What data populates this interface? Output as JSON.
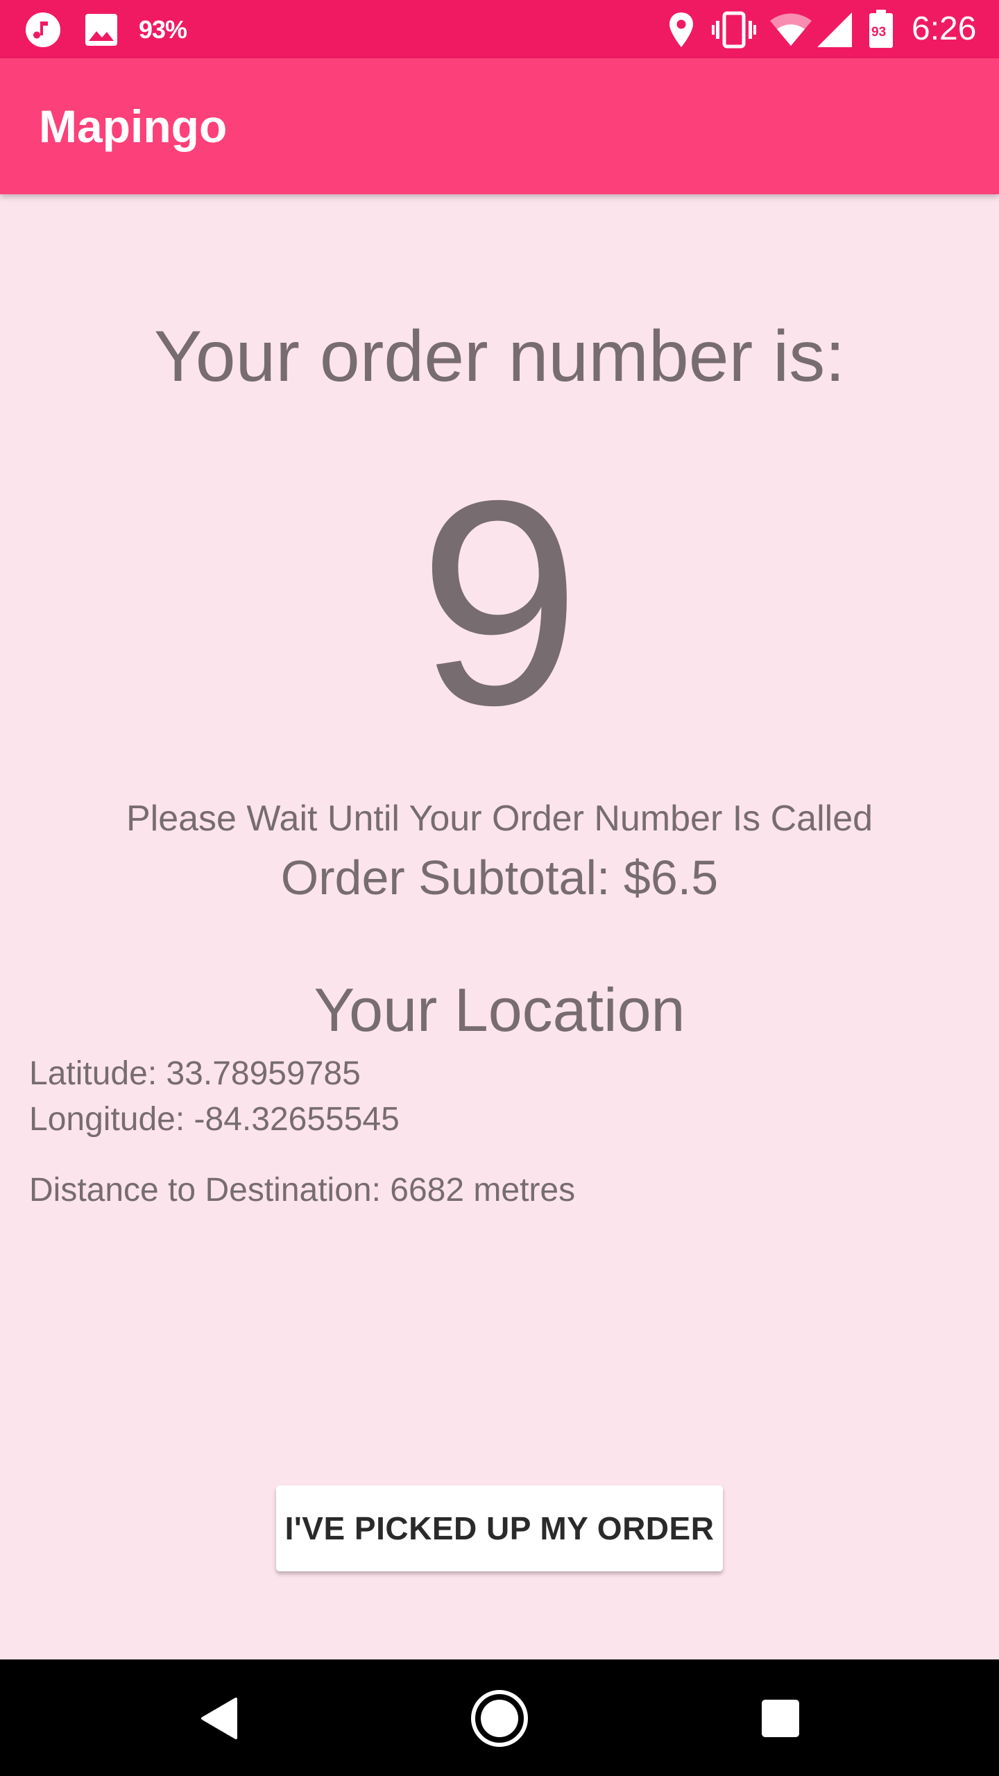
{
  "status_bar": {
    "battery_percent_label": "93%",
    "battery_level_label": "93",
    "time": "6:26",
    "icons": [
      "music-note-icon",
      "image-icon",
      "location-pin-icon",
      "vibrate-icon",
      "wifi-icon",
      "cell-signal-icon",
      "battery-icon"
    ]
  },
  "app_bar": {
    "title": "Mapingo"
  },
  "order": {
    "heading": "Your order number is:",
    "number": "9",
    "wait_message": "Please Wait Until Your Order Number Is Called",
    "subtotal": "Order Subtotal: $6.5"
  },
  "location": {
    "heading": "Your Location",
    "latitude": "Latitude: 33.78959785",
    "longitude": "Longitude: -84.32655545",
    "distance": "Distance to Destination: 6682 metres"
  },
  "actions": {
    "pickup_label": "I'VE PICKED UP MY ORDER"
  },
  "nav_bar": {
    "icons": [
      "back-icon",
      "home-icon",
      "recents-icon"
    ]
  },
  "colors": {
    "status_bar": "#F01A62",
    "app_bar": "#FC4079",
    "background": "#FCE4EC",
    "text": "#776C70"
  }
}
